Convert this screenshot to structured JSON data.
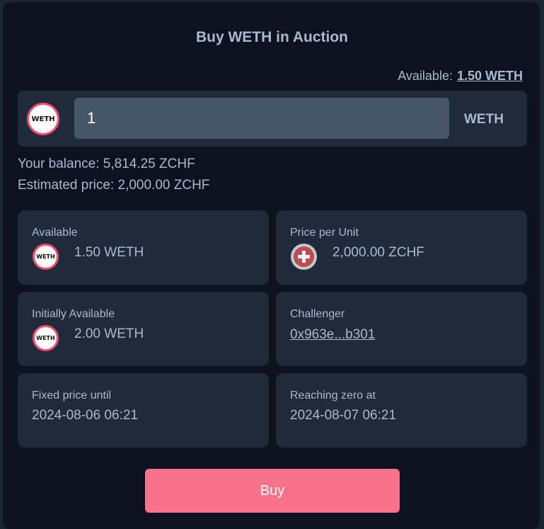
{
  "title": "Buy WETH in Auction",
  "available_top": {
    "label": "Available:",
    "value": "1.50 WETH"
  },
  "input": {
    "token_icon": "weth-logo-icon",
    "token_icon_text": "WETH",
    "value": "1",
    "unit": "WETH"
  },
  "balance_line": "Your balance: 5,814.25 ZCHF",
  "estimated_line": "Estimated price: 2,000.00 ZCHF",
  "cards": {
    "available": {
      "label": "Available",
      "icon": "weth-logo-icon",
      "icon_text": "WETH",
      "value": "1.50 WETH"
    },
    "price_per_unit": {
      "label": "Price per Unit",
      "icon": "zchf-logo-icon",
      "value": "2,000.00 ZCHF"
    },
    "initially_available": {
      "label": "Initially Available",
      "icon": "weth-logo-icon",
      "icon_text": "WETH",
      "value": "2.00 WETH"
    },
    "challenger": {
      "label": "Challenger",
      "value": "0x963e...b301"
    },
    "fixed_price_until": {
      "label": "Fixed price until",
      "value": "2024-08-06 06:21"
    },
    "reaching_zero_at": {
      "label": "Reaching zero at",
      "value": "2024-08-07 06:21"
    }
  },
  "buy_button": "Buy",
  "colors": {
    "background": "#0c1220",
    "card": "#1f2a3b",
    "text": "#a9b9cf",
    "accent": "#f7728a",
    "input": "#475569"
  }
}
